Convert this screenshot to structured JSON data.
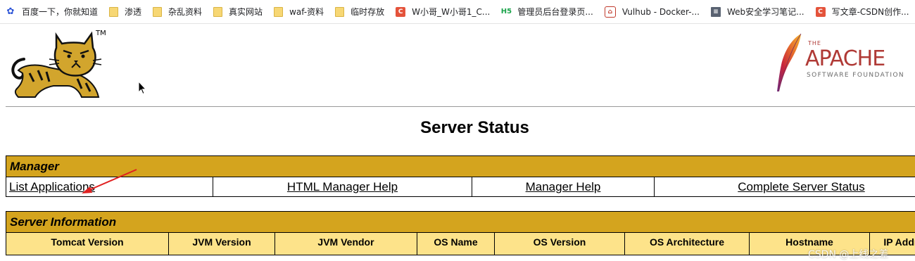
{
  "bookmarks": [
    {
      "icon": "paw-icon",
      "label": "百度一下，你就知道"
    },
    {
      "icon": "folder-icon",
      "label": "渗透"
    },
    {
      "icon": "folder-icon",
      "label": "杂乱资料"
    },
    {
      "icon": "folder-icon",
      "label": "真实网站"
    },
    {
      "icon": "folder-icon",
      "label": "waf-资料"
    },
    {
      "icon": "folder-icon",
      "label": "临时存放"
    },
    {
      "icon": "csdn-icon",
      "icon_text": "C",
      "label": "W小哥_W小哥1_C..."
    },
    {
      "icon": "h5-icon",
      "icon_text": "H5",
      "label": "管理员后台登录页..."
    },
    {
      "icon": "docker-icon",
      "icon_text": "⌂",
      "label": "Vulhub - Docker-..."
    },
    {
      "icon": "document-icon",
      "icon_text": "≡",
      "label": "Web安全学习笔记..."
    },
    {
      "icon": "csdn-icon",
      "icon_text": "C",
      "label": "写文章-CSDN创作..."
    }
  ],
  "logo": {
    "trademark": "TM"
  },
  "apache": {
    "the": "THE",
    "name": "APACHE",
    "sub": "SOFTWARE FOUNDATION"
  },
  "page_title": "Server Status",
  "manager": {
    "title": "Manager",
    "links": [
      "List Applications",
      "HTML Manager Help",
      "Manager Help",
      "Complete Server Status"
    ]
  },
  "server_info": {
    "title": "Server Information",
    "headers": [
      "Tomcat Version",
      "JVM Version",
      "JVM Vendor",
      "OS Name",
      "OS Version",
      "OS Architecture",
      "Hostname",
      "IP Address"
    ]
  },
  "watermark": "CSDN @上线之差",
  "colors": {
    "section_header": "#d4a41e",
    "column_header": "#fde38a",
    "apache_red": "#b03a36",
    "annotation_arrow": "#e02020"
  }
}
